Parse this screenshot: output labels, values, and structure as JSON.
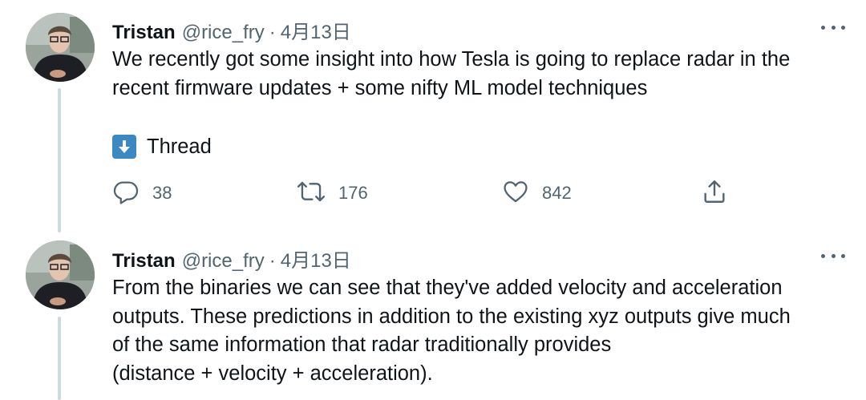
{
  "tweets": [
    {
      "author_name": "Tristan",
      "handle": "@rice_fry",
      "separator": "·",
      "date": "4月13日",
      "text": "We recently got some insight into how Tesla is going to replace radar in the recent firmware updates + some nifty ML model techniques",
      "thread_label": "Thread",
      "thread_icon": "down-arrow-emoji",
      "reply_count": "38",
      "retweet_count": "176",
      "like_count": "842"
    },
    {
      "author_name": "Tristan",
      "handle": "@rice_fry",
      "separator": "·",
      "date": "4月13日",
      "text_lines": [
        "From the binaries we can see that they've added velocity and acceleration",
        "outputs. These predictions in addition to the existing xyz outputs give much",
        "of the same information that radar traditionally provides",
        "(distance + velocity + acceleration)."
      ]
    }
  ],
  "colors": {
    "text": "#0f1419",
    "secondary": "#536471",
    "thread_line": "#cfd9de",
    "emoji_blue": "#3b88c3"
  }
}
